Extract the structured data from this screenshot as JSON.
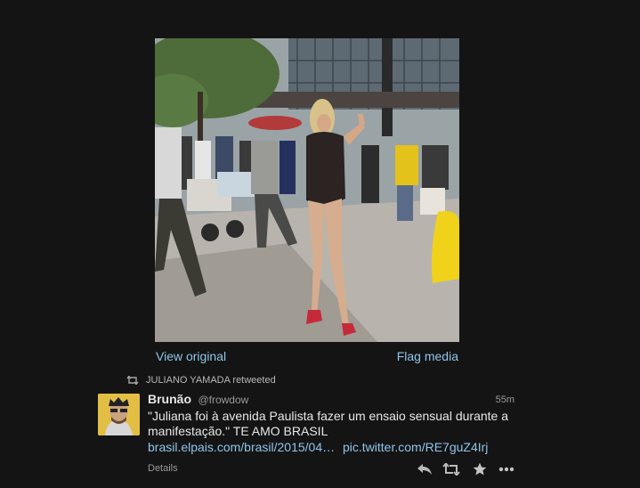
{
  "media": {
    "photo_alt": "",
    "view_original": "View original",
    "flag_media": "Flag media"
  },
  "retweet_context": {
    "text": "JULIANO YAMADA retweeted",
    "icon": "retweet-icon"
  },
  "tweet": {
    "fullname": "Brunão",
    "username": "@frowdow",
    "time": "55m",
    "text": "\"Juliana foi à avenida Paulista fazer um ensaio sensual durante a manifestação.\" TE AMO BRASIL",
    "link1": "brasil.elpais.com/brasil/2015/04…",
    "link2": "pic.twitter.com/RE7guZ4Irj",
    "details": "Details"
  },
  "actions": [
    "reply-icon",
    "retweet-icon",
    "favorite-star-icon",
    "more-ellipsis-icon"
  ],
  "colors": {
    "background": "#141414",
    "link": "#8ec5ea",
    "avatar_bg": "#e2bf44"
  }
}
